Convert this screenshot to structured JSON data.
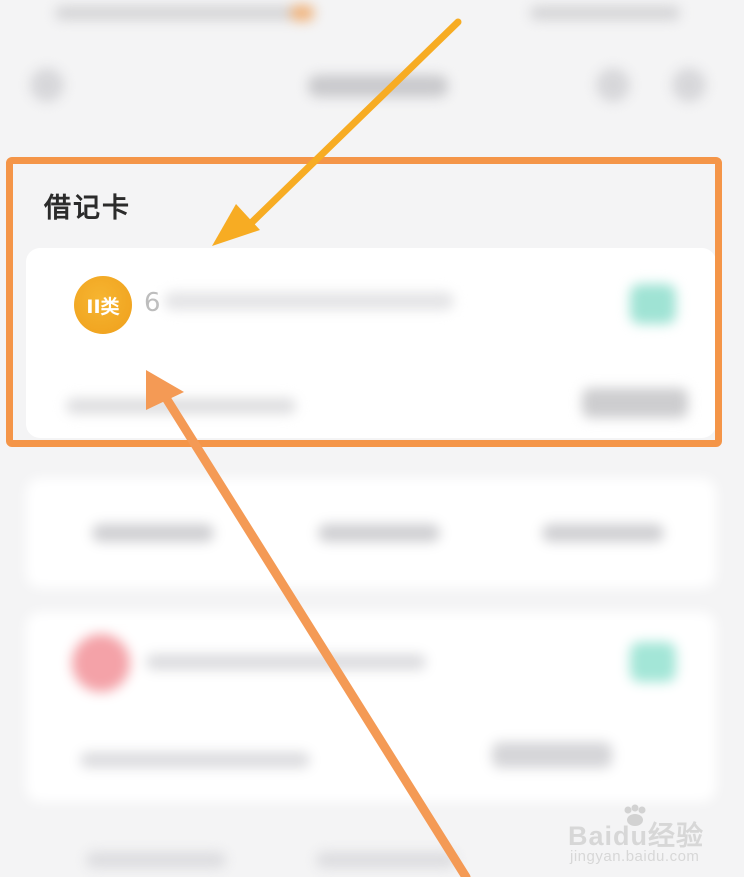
{
  "section": {
    "title": "借记卡"
  },
  "cards": [
    {
      "badge": "II类",
      "number_visible": "6"
    }
  ],
  "annotations": {
    "box_color": "#f49548",
    "arrow_top_color": "#f7ac23",
    "arrow_bottom_color": "#f49a55"
  },
  "watermark": {
    "brand": "Baidu经验",
    "url": "jingyan.baidu.com"
  }
}
